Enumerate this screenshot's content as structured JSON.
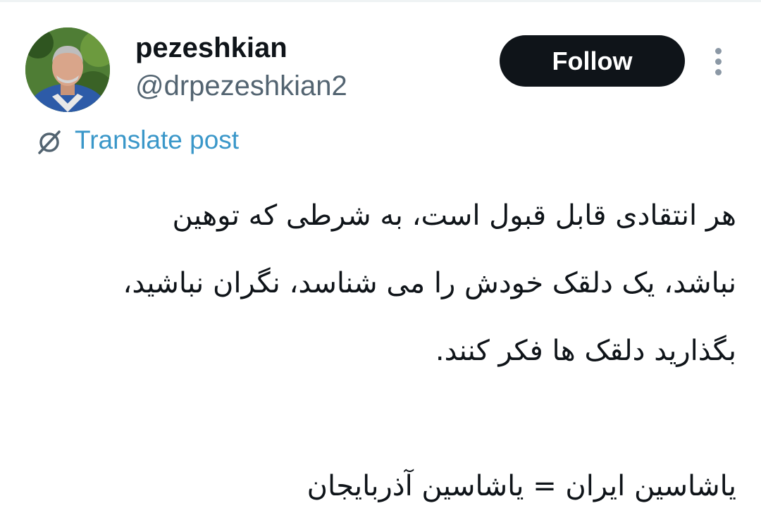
{
  "author": {
    "display_name": "pezeshkian",
    "handle": "@drpezeshkian2",
    "avatar_alt": "profile photo"
  },
  "actions": {
    "follow_label": "Follow",
    "more_icon": "more-vertical-icon"
  },
  "translate": {
    "label": "Translate post",
    "icon": "translate-globe-icon"
  },
  "post": {
    "paragraph_1": [
      "هر انتقادی قابل قبول است، به شرطی که توهین",
      "نباشد، یک دلقک خودش را می شناسد، نگران نباشید،",
      "بگذارید دلقک ها فکر کنند."
    ],
    "paragraph_2": "یاشاسین ایران = یاشاسین آذربایجان"
  },
  "colors": {
    "follow_bg": "#0f1419",
    "link": "#3a97c9",
    "handle": "#536471",
    "text": "#0f1419"
  }
}
